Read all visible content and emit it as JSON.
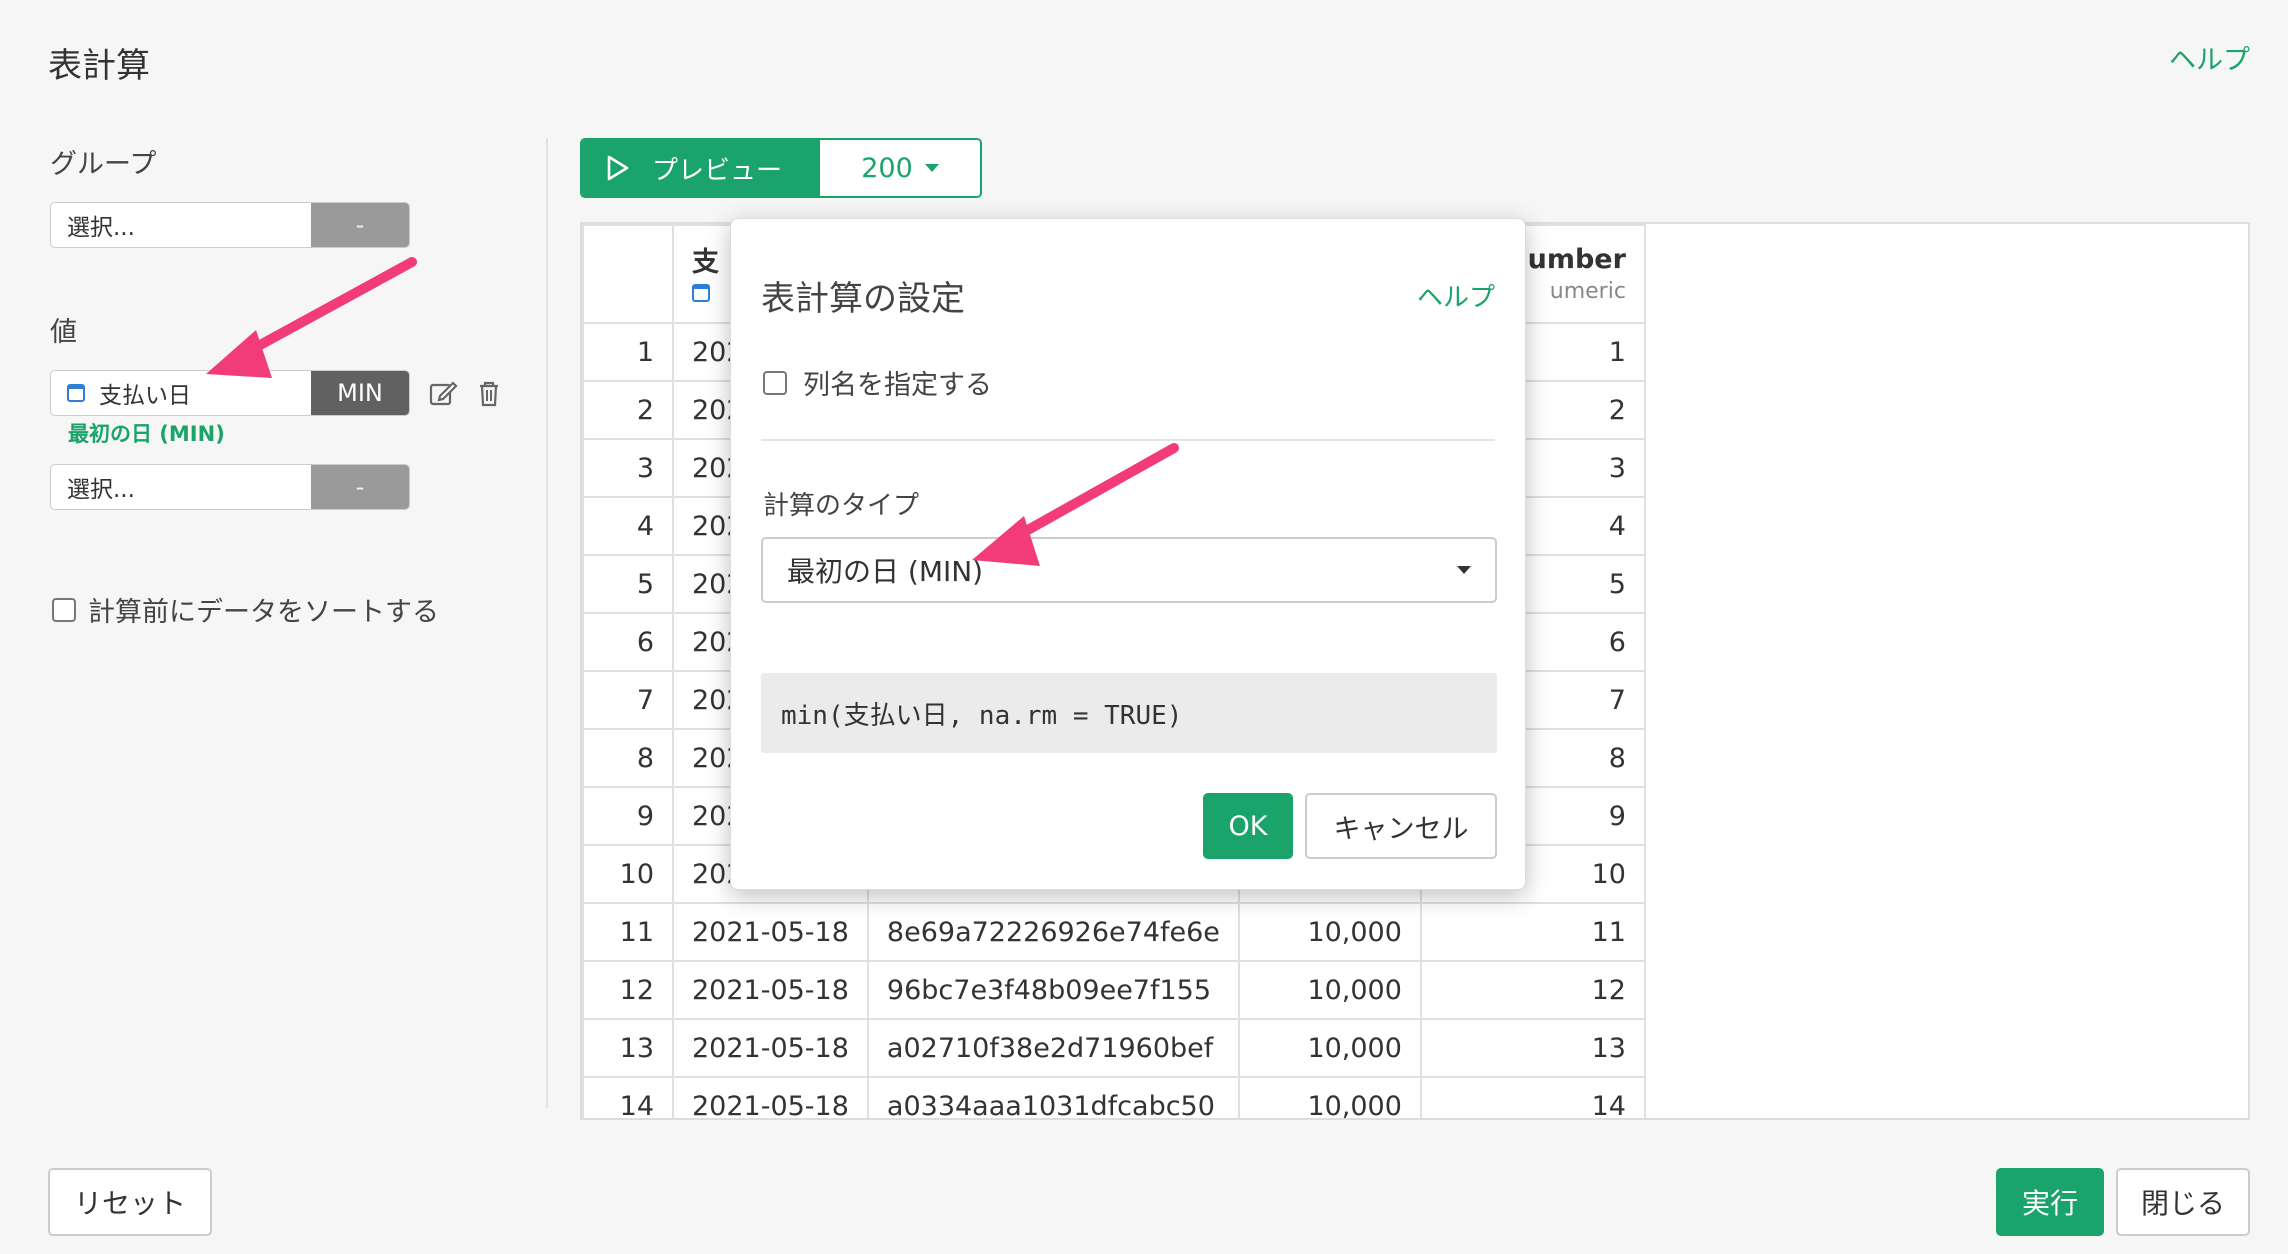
{
  "header": {
    "title": "表計算",
    "help": "ヘルプ"
  },
  "left": {
    "group_label": "グループ",
    "group_select": {
      "placeholder": "選択...",
      "button": "-"
    },
    "value_label": "値",
    "value_item": {
      "column": "支払い日",
      "func": "MIN",
      "sublabel": "最初の日 (MIN)"
    },
    "value_select2": {
      "placeholder": "選択...",
      "button": "-"
    },
    "sort_label": "計算前にデータをソートする"
  },
  "toolbar": {
    "preview": "プレビュー",
    "count": "200"
  },
  "table": {
    "headers": [
      {
        "name": "",
        "type": ""
      },
      {
        "name": "支",
        "type": ""
      },
      {
        "name": "",
        "type": ""
      },
      {
        "name": "",
        "type": ""
      },
      {
        "name": "umber",
        "type": "umeric"
      }
    ],
    "rows": [
      [
        "1",
        "202",
        "",
        "",
        "1"
      ],
      [
        "2",
        "202",
        "",
        "",
        "2"
      ],
      [
        "3",
        "202",
        "",
        "",
        "3"
      ],
      [
        "4",
        "202",
        "",
        "",
        "4"
      ],
      [
        "5",
        "202",
        "",
        "",
        "5"
      ],
      [
        "6",
        "202",
        "",
        "",
        "6"
      ],
      [
        "7",
        "202",
        "",
        "",
        "7"
      ],
      [
        "8",
        "202",
        "",
        "",
        "8"
      ],
      [
        "9",
        "202",
        "",
        "",
        "9"
      ],
      [
        "10",
        "202",
        "",
        "",
        "10"
      ],
      [
        "11",
        "2021-05-18",
        "8e69a72226926e74fe6e",
        "10,000",
        "11"
      ],
      [
        "12",
        "2021-05-18",
        "96bc7e3f48b09ee7f155",
        "10,000",
        "12"
      ],
      [
        "13",
        "2021-05-18",
        "a02710f38e2d71960bef",
        "10,000",
        "13"
      ],
      [
        "14",
        "2021-05-18",
        "a0334aaa1031dfcabc50",
        "10,000",
        "14"
      ]
    ]
  },
  "dialog": {
    "title": "表計算の設定",
    "help": "ヘルプ",
    "specify_name": "列名を指定する",
    "calc_type_label": "計算のタイプ",
    "calc_type_value": "最初の日 (MIN)",
    "code": "min(支払い日, na.rm = TRUE)",
    "ok": "OK",
    "cancel": "キャンセル"
  },
  "footer": {
    "reset": "リセット",
    "run": "実行",
    "close": "閉じる"
  },
  "colors": {
    "accent": "#1aa36a",
    "arrow": "#f23c7a",
    "calendar": "#2f7fd6"
  }
}
